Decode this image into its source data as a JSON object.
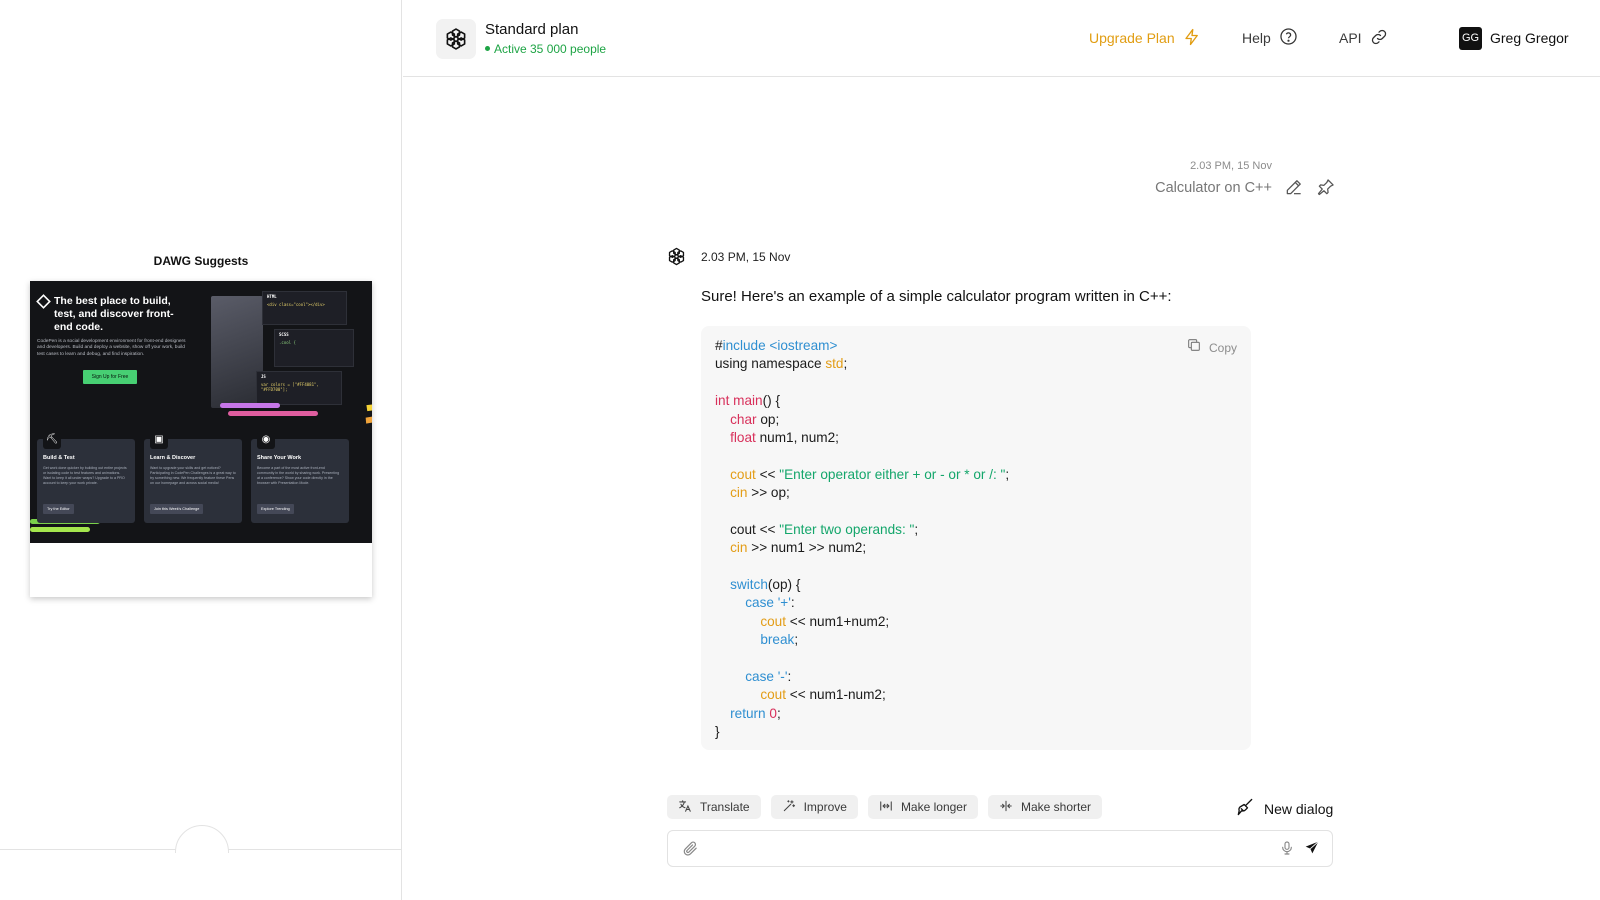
{
  "left_panel": {
    "suggest_title": "DAWG Suggests",
    "preview": {
      "headline": "The best place to build, test, and discover front-end code.",
      "subtext": "CodePen is a social development environment for front-end designers and developers. Build and deploy a website, show off your work, build test cases to learn and debug, and find inspiration.",
      "signup_label": "Sign Up for Free",
      "panes": [
        {
          "title": "HTML",
          "code": "<div class=\"cool\"></div>"
        },
        {
          "title": "SCSS",
          "code": ".cool {"
        },
        {
          "title": "JS",
          "code": "var colors = [\"#FF4081\", \"#FFD700\"];"
        }
      ],
      "cards": [
        {
          "title": "Build & Test",
          "text": "Get work done quicker by building out entire projects or isolating code to test features and animations. Want to keep it all under wraps? Upgrade to a PRO account to keep your work private.",
          "button": "Try the Editor"
        },
        {
          "title": "Learn & Discover",
          "text": "Want to upgrade your skills and get noticed? Participating in CodePen Challenges is a great way to try something new. We frequently feature these Pens on our homepage and across social media!",
          "button": "Join this Week's Challenge"
        },
        {
          "title": "Share Your Work",
          "text": "Become a part of the most active front-end community in the world by sharing work. Presenting at a conference? Show your code directly in the browser with Presentation Mode.",
          "button": "Explore Trending"
        }
      ]
    }
  },
  "header": {
    "plan_name": "Standard plan",
    "plan_status": "Active 35 000 people",
    "upgrade_label": "Upgrade Plan",
    "help_label": "Help",
    "api_label": "API",
    "user_initials": "GG",
    "user_name": "Greg Gregor",
    "accent_color": "#e19d12",
    "status_color": "#1ea445"
  },
  "chat": {
    "user_message": {
      "time": "2.03 PM, 15 Nov",
      "text": "Calculator on C++"
    },
    "bot_message": {
      "time": "2.03 PM, 15 Nov",
      "intro": "Sure! Here's an example of a simple calculator program written in C++:",
      "copy_label": "Copy",
      "code_lines": [
        [
          {
            "t": "#"
          },
          {
            "t": "include <iostream>",
            "c": "k-blue"
          }
        ],
        [
          {
            "t": "using namespace "
          },
          {
            "t": "std",
            "c": "k-orange"
          },
          {
            "t": ";"
          }
        ],
        [],
        [
          {
            "t": "int main",
            "c": "k-red"
          },
          {
            "t": "() {"
          }
        ],
        [
          {
            "t": "    "
          },
          {
            "t": "char",
            "c": "k-red"
          },
          {
            "t": " op;"
          }
        ],
        [
          {
            "t": "    "
          },
          {
            "t": "float",
            "c": "k-red"
          },
          {
            "t": " num1, num2;"
          }
        ],
        [],
        [
          {
            "t": "    "
          },
          {
            "t": "cout",
            "c": "k-orange"
          },
          {
            "t": " << "
          },
          {
            "t": "\"Enter operator either + or - or * or /: \"",
            "c": "k-green"
          },
          {
            "t": ";"
          }
        ],
        [
          {
            "t": "    "
          },
          {
            "t": "cin",
            "c": "k-orange"
          },
          {
            "t": " >> op;"
          }
        ],
        [],
        [
          {
            "t": "    cout << "
          },
          {
            "t": "\"Enter two operands: \"",
            "c": "k-green"
          },
          {
            "t": ";"
          }
        ],
        [
          {
            "t": "    "
          },
          {
            "t": "cin",
            "c": "k-orange"
          },
          {
            "t": " >> num1 >> num2;"
          }
        ],
        [],
        [
          {
            "t": "    "
          },
          {
            "t": "switch",
            "c": "k-blue"
          },
          {
            "t": "(op) {"
          }
        ],
        [
          {
            "t": "        "
          },
          {
            "t": "case '+'",
            "c": "k-blue"
          },
          {
            "t": ":"
          }
        ],
        [
          {
            "t": "            "
          },
          {
            "t": "cout",
            "c": "k-orange"
          },
          {
            "t": " << num1+num2;"
          }
        ],
        [
          {
            "t": "            "
          },
          {
            "t": "break",
            "c": "k-blue"
          },
          {
            "t": ";"
          }
        ],
        [],
        [
          {
            "t": "        "
          },
          {
            "t": "case '-'",
            "c": "k-blue"
          },
          {
            "t": ":"
          }
        ],
        [
          {
            "t": "            "
          },
          {
            "t": "cout",
            "c": "k-orange"
          },
          {
            "t": " << num1-num2;"
          }
        ],
        [
          {
            "t": "    "
          },
          {
            "t": "return ",
            "c": "k-blue"
          },
          {
            "t": "0",
            "c": "k-red"
          },
          {
            "t": ";"
          }
        ],
        [
          {
            "t": "}"
          }
        ]
      ]
    }
  },
  "tools": {
    "translate": "Translate",
    "improve": "Improve",
    "make_longer": "Make longer",
    "make_shorter": "Make shorter",
    "new_dialog": "New dialog"
  },
  "composer": {
    "placeholder": "",
    "value": ""
  },
  "icons": {
    "plan_logo": "openai-logo-icon",
    "upgrade": "lightning-icon",
    "help": "question-circle-icon",
    "api": "link-icon",
    "edit": "pencil-icon",
    "pin": "pin-icon",
    "copy": "copy-icon",
    "translate": "translate-icon",
    "improve": "magic-wand-icon",
    "longer": "expand-horizontal-icon",
    "shorter": "collapse-horizontal-icon",
    "new_dialog": "broom-icon",
    "attach": "paperclip-icon",
    "mic": "microphone-icon",
    "send": "send-icon"
  }
}
